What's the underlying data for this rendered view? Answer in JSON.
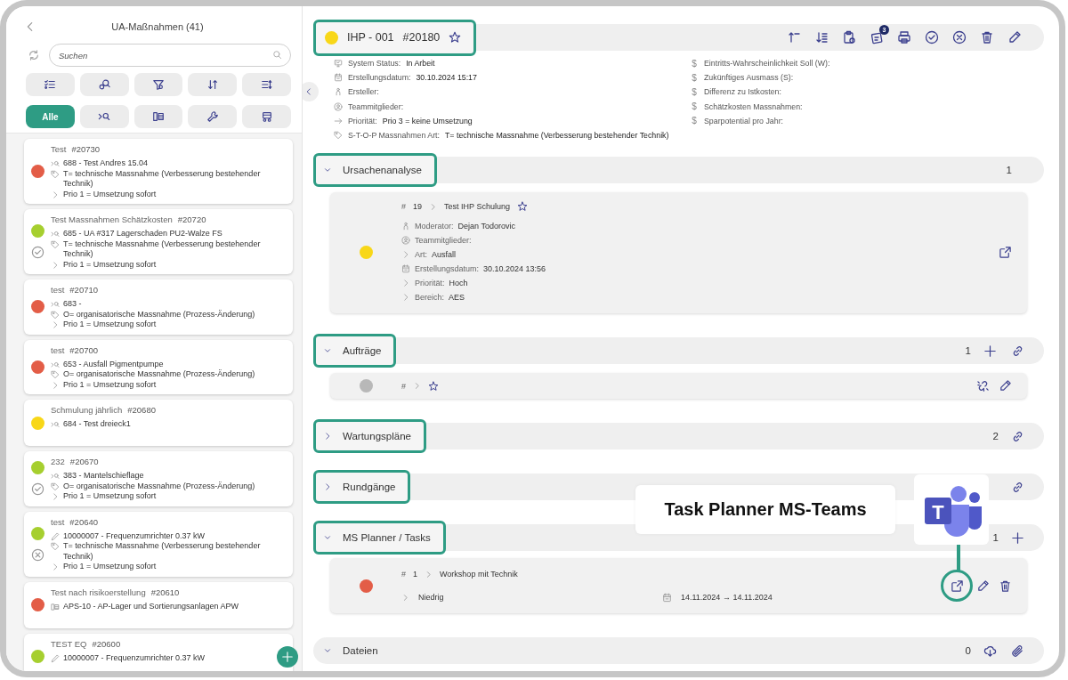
{
  "list_panel": {
    "title": "UA-Maßnahmen (41)",
    "search": {
      "placeholder": "Suchen"
    },
    "tool_buttons": [
      {
        "kind": "checklist"
      },
      {
        "kind": "gear-search"
      },
      {
        "kind": "filter"
      },
      {
        "kind": "sort"
      },
      {
        "kind": "list-sort"
      }
    ],
    "filter_buttons": [
      {
        "kind": "all",
        "label": "Alle",
        "selected": true
      },
      {
        "kind": "analysis",
        "selected": false
      },
      {
        "kind": "machine",
        "selected": false
      },
      {
        "kind": "wrench",
        "selected": false
      },
      {
        "kind": "vehicle",
        "selected": false
      }
    ]
  },
  "measures": [
    {
      "title": "Test",
      "number": "#20730",
      "color": "#e35d47",
      "done": false,
      "cancelled": false,
      "lines": [
        {
          "kind": "analysis",
          "text": "688 - Test Andres 15.04"
        },
        {
          "kind": "type",
          "text": "T= technische Massnahme (Verbesserung bestehender Technik)"
        },
        {
          "kind": "priority",
          "text": "Prio 1 = Umsetzung sofort"
        }
      ]
    },
    {
      "title": "Test Massnahmen Schätzkosten",
      "number": "#20720",
      "color": "#a6cf2f",
      "done": true,
      "cancelled": false,
      "lines": [
        {
          "kind": "analysis",
          "text": "685 - UA #317 Lagerschaden PU2-Walze FS"
        },
        {
          "kind": "type",
          "text": "T= technische Massnahme (Verbesserung bestehender Technik)"
        },
        {
          "kind": "priority",
          "text": "Prio 1 = Umsetzung sofort"
        }
      ]
    },
    {
      "title": "test",
      "number": "#20710",
      "color": "#e35d47",
      "done": false,
      "cancelled": false,
      "lines": [
        {
          "kind": "analysis",
          "text": "683 -"
        },
        {
          "kind": "type",
          "text": "O= organisatorische Massnahme (Prozess-Änderung)"
        },
        {
          "kind": "priority",
          "text": "Prio 1 = Umsetzung sofort"
        }
      ]
    },
    {
      "title": "test",
      "number": "#20700",
      "color": "#e35d47",
      "done": false,
      "cancelled": false,
      "lines": [
        {
          "kind": "analysis",
          "text": "653 - Ausfall Pigmentpumpe"
        },
        {
          "kind": "type",
          "text": "O= organisatorische Massnahme (Prozess-Änderung)"
        },
        {
          "kind": "priority",
          "text": "Prio 1 = Umsetzung sofort"
        }
      ]
    },
    {
      "title": "Schmulung jährlich",
      "number": "#20680",
      "color": "#f8d718",
      "done": false,
      "cancelled": false,
      "lines": [
        {
          "kind": "analysis",
          "text": "684 - Test dreieck1"
        }
      ]
    },
    {
      "title": "232",
      "number": "#20670",
      "color": "#a6cf2f",
      "done": true,
      "cancelled": false,
      "lines": [
        {
          "kind": "analysis",
          "text": "383 - Mantelschieflage"
        },
        {
          "kind": "type",
          "text": "O= organisatorische Massnahme (Prozess-Änderung)"
        },
        {
          "kind": "priority",
          "text": "Prio 1 = Umsetzung sofort"
        }
      ]
    },
    {
      "title": "test",
      "number": "#20640",
      "color": "#a6cf2f",
      "done": false,
      "cancelled": true,
      "lines": [
        {
          "kind": "part",
          "text": "10000007 - Frequenzumrichter 0.37 kW"
        },
        {
          "kind": "type",
          "text": "T= technische Massnahme (Verbesserung bestehender Technik)"
        },
        {
          "kind": "priority",
          "text": "Prio 1 = Umsetzung sofort"
        }
      ]
    },
    {
      "title": "Test nach risikoerstellung",
      "number": "#20610",
      "color": "#e35d47",
      "done": false,
      "cancelled": false,
      "lines": [
        {
          "kind": "machine",
          "text": "APS-10 - AP-Lager und Sortierungsanlagen APW"
        }
      ]
    },
    {
      "title": "TEST EQ",
      "number": "#20600",
      "color": "#a6cf2f",
      "done": false,
      "cancelled": false,
      "lines": [
        {
          "kind": "part",
          "text": "10000007 - Frequenzumrichter 0.37 kW"
        }
      ]
    }
  ],
  "detail": {
    "color": "#f8d718",
    "title": "IHP - 001",
    "number": "#20180",
    "starred": false,
    "highlighted": true,
    "toolbar": [
      {
        "kind": "sort-asc"
      },
      {
        "kind": "sort-desc"
      },
      {
        "kind": "clipboard"
      },
      {
        "kind": "tasklist",
        "badge": "3"
      },
      {
        "kind": "printer"
      },
      {
        "kind": "check-circle"
      },
      {
        "kind": "x-circle"
      },
      {
        "kind": "trash"
      },
      {
        "kind": "pencil"
      }
    ],
    "info_left": [
      {
        "kind": "status",
        "label": "System Status:",
        "value": "In Arbeit"
      },
      {
        "kind": "created",
        "label": "Erstellungsdatum:",
        "value": "30.10.2024 15:17"
      },
      {
        "kind": "creator",
        "label": "Ersteller:"
      },
      {
        "kind": "team",
        "label": "Teammitglieder:"
      },
      {
        "kind": "priority",
        "label": "Priorität:",
        "value": "Prio 3 = keine Umsetzung"
      },
      {
        "kind": "type",
        "label": "S-T-O-P Massnahmen Art:",
        "value": "T= technische Massnahme (Verbesserung bestehender Technik)"
      }
    ],
    "info_right": [
      {
        "symbol": "$",
        "label": "Eintritts-Wahrscheinlichkeit Soll (W):"
      },
      {
        "symbol": "$",
        "label": "Zukünftiges Ausmass (S):"
      },
      {
        "symbol": "$",
        "label": "Differenz zu Istkosten:"
      },
      {
        "symbol": "$",
        "label": "Schätzkosten Massnahmen:"
      },
      {
        "symbol": "$",
        "label": "Sparpotential pro Jahr:"
      }
    ]
  },
  "sections": [
    {
      "title": "Ursachenanalyse",
      "expanded": true,
      "highlighted": true,
      "count": "1",
      "items": [
        {
          "kind": "analysis",
          "color": "#f8d718",
          "hash": "#",
          "number": "19",
          "name": "Test IHP Schulung",
          "starred": false,
          "fields": [
            {
              "kind": "moderator",
              "label": "Moderator:",
              "value": "Dejan Todorovic"
            },
            {
              "kind": "team",
              "label": "Teammitglieder:"
            },
            {
              "kind": "category",
              "label": "Art:",
              "value": "Ausfall"
            },
            {
              "kind": "created",
              "label": "Erstellungsdatum:",
              "value": "30.10.2024 13:56"
            },
            {
              "kind": "priority-level",
              "label": "Priorität:",
              "value": "Hoch"
            },
            {
              "kind": "area",
              "label": "Bereich:",
              "value": "AES"
            }
          ],
          "actions": [
            {
              "kind": "external",
              "highlighted": false
            }
          ]
        }
      ]
    },
    {
      "title": "Aufträge",
      "expanded": true,
      "highlighted": true,
      "count": "1",
      "actions": [
        {
          "kind": "plus"
        },
        {
          "kind": "link"
        }
      ],
      "items": [
        {
          "kind": "order",
          "color": "#b8b8b8",
          "hash": "#",
          "starred": false,
          "actions": [
            {
              "kind": "unlink",
              "highlighted": false
            },
            {
              "kind": "pencil",
              "highlighted": false
            }
          ]
        }
      ]
    },
    {
      "title": "Wartungspläne",
      "expanded": false,
      "highlighted": true,
      "count": "2",
      "actions": [
        {
          "kind": "link"
        }
      ]
    },
    {
      "title": "Rundgänge",
      "expanded": false,
      "highlighted": true,
      "actions": [
        {
          "kind": "link"
        }
      ]
    },
    {
      "title": "MS Planner / Tasks",
      "expanded": true,
      "highlighted": true,
      "count": "1",
      "actions": [
        {
          "kind": "plus"
        }
      ],
      "items": [
        {
          "kind": "task",
          "color": "#e35d47",
          "hash": "#",
          "number": "1",
          "name": "Workshop mit Technik",
          "priority": "Niedrig",
          "dates": "14.11.2024 → 14.11.2024",
          "actions": [
            {
              "kind": "external",
              "highlighted": true
            },
            {
              "kind": "pencil",
              "highlighted": false
            },
            {
              "kind": "trash",
              "highlighted": false
            }
          ]
        }
      ]
    },
    {
      "title": "Dateien",
      "expanded": true,
      "highlighted": false,
      "count": "0",
      "actions": [
        {
          "kind": "cloud-download"
        },
        {
          "kind": "paperclip"
        }
      ]
    }
  ],
  "callout": {
    "text": "Task Planner MS-Teams",
    "logo_letter": "T"
  }
}
